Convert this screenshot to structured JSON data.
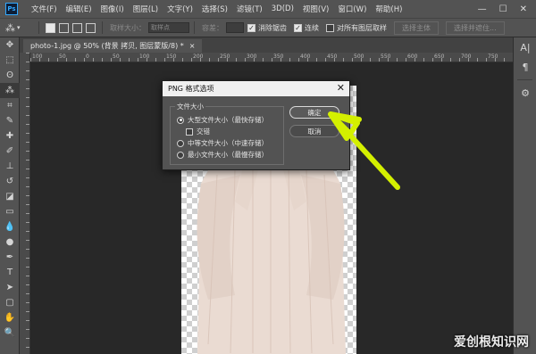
{
  "app": {
    "logo_text": "Ps"
  },
  "menu": [
    "文件(F)",
    "编辑(E)",
    "图像(I)",
    "图层(L)",
    "文字(Y)",
    "选择(S)",
    "滤镜(T)",
    "3D(D)",
    "视图(V)",
    "窗口(W)",
    "帮助(H)"
  ],
  "window_controls": {
    "minimize": "—",
    "maximize": "☐",
    "close": "✕"
  },
  "options": {
    "feather_label": "取样大小：",
    "feather_value": "取样点",
    "tolerance_label": "容差：",
    "antialias_label": "消除锯齿",
    "antialias_checked": true,
    "contiguous_label": "连续",
    "contiguous_checked": true,
    "sample_all_label": "对所有图层取样",
    "sample_all_checked": false,
    "select_subject_label": "选择主体",
    "select_mask_label": "选择并遮住..."
  },
  "document": {
    "tab_title": "photo-1.jpg @ 50% (背景 拷贝, 图层蒙版/8) *",
    "close": "×"
  },
  "ruler": {
    "top_ticks": [
      "100",
      "50",
      "0",
      "50",
      "100",
      "150",
      "200",
      "250",
      "300",
      "350",
      "400",
      "450",
      "500",
      "550",
      "600",
      "650",
      "700",
      "750"
    ]
  },
  "tools": [
    {
      "name": "move-tool",
      "glyph": "✥"
    },
    {
      "name": "marquee-tool",
      "glyph": "⬚"
    },
    {
      "name": "lasso-tool",
      "glyph": "ʘ"
    },
    {
      "name": "magic-wand-tool",
      "glyph": "⁂"
    },
    {
      "name": "crop-tool",
      "glyph": "⌗"
    },
    {
      "name": "eyedropper-tool",
      "glyph": "✎"
    },
    {
      "name": "healing-brush-tool",
      "glyph": "✚"
    },
    {
      "name": "brush-tool",
      "glyph": "✐"
    },
    {
      "name": "clone-stamp-tool",
      "glyph": "⊥"
    },
    {
      "name": "history-brush-tool",
      "glyph": "↺"
    },
    {
      "name": "eraser-tool",
      "glyph": "◪"
    },
    {
      "name": "gradient-tool",
      "glyph": "▭"
    },
    {
      "name": "blur-tool",
      "glyph": "💧"
    },
    {
      "name": "dodge-tool",
      "glyph": "●"
    },
    {
      "name": "pen-tool",
      "glyph": "✒"
    },
    {
      "name": "type-tool",
      "glyph": "T"
    },
    {
      "name": "path-selection-tool",
      "glyph": "➤"
    },
    {
      "name": "shape-tool",
      "glyph": "▢"
    },
    {
      "name": "hand-tool",
      "glyph": "✋"
    },
    {
      "name": "zoom-tool",
      "glyph": "🔍"
    }
  ],
  "right_panel": [
    {
      "name": "character-panel-icon",
      "glyph": "A|"
    },
    {
      "name": "paragraph-panel-icon",
      "glyph": "¶"
    },
    {
      "name": "properties-panel-icon",
      "glyph": "⚙"
    }
  ],
  "dialog": {
    "title": "PNG 格式选项",
    "close": "✕",
    "group_label": "文件大小",
    "options": [
      {
        "label": "大型文件大小（最快存储）",
        "selected": true
      },
      {
        "label": "交错",
        "checkbox": true,
        "checked": false
      },
      {
        "label": "中等文件大小（中速存储）",
        "selected": false
      },
      {
        "label": "最小文件大小（最慢存储）",
        "selected": false
      }
    ],
    "ok_label": "确定",
    "cancel_label": "取消"
  },
  "annotation": {
    "color": "#d4f000"
  },
  "watermark": "爱创根知识网",
  "colors": {
    "ui_bg": "#535353",
    "workspace_bg": "#282828",
    "accent": "#31a8ff"
  }
}
